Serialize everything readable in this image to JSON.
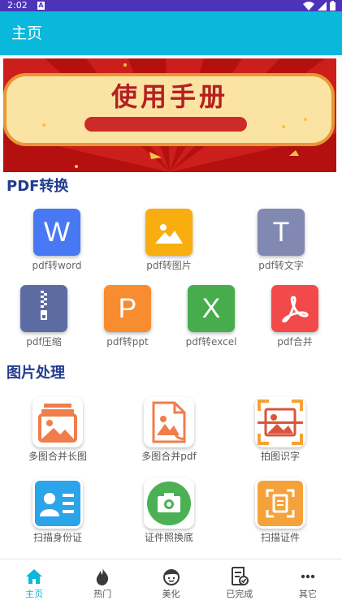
{
  "status_bar": {
    "time": "2:02",
    "notification_letter": "A"
  },
  "app_bar": {
    "title": "主页"
  },
  "banner": {
    "text": "使用手册"
  },
  "pdf_section": {
    "title": "PDF转换",
    "items": [
      {
        "label": "pdf转word",
        "glyph": "W",
        "color": "#4878f3"
      },
      {
        "label": "pdf转图片",
        "glyph": "",
        "color": "#f8ae0f"
      },
      {
        "label": "pdf转文字",
        "glyph": "T",
        "color": "#8189b3"
      },
      {
        "label": "pdf压缩",
        "glyph": "",
        "color": "#5d6ba3"
      },
      {
        "label": "pdf转ppt",
        "glyph": "P",
        "color": "#f88c31"
      },
      {
        "label": "pdf转excel",
        "glyph": "X",
        "color": "#47ad4c"
      },
      {
        "label": "pdf合并",
        "glyph": "",
        "color": "#f24a4a"
      }
    ]
  },
  "image_section": {
    "title": "图片处理",
    "items": [
      {
        "label": "多图合并长图"
      },
      {
        "label": "多图合并pdf"
      },
      {
        "label": "拍图识字"
      },
      {
        "label": "扫描身份证"
      },
      {
        "label": "证件照换底"
      },
      {
        "label": "扫描证件"
      }
    ]
  },
  "bottom_nav": {
    "items": [
      {
        "label": "主页",
        "active": true
      },
      {
        "label": "热门",
        "active": false
      },
      {
        "label": "美化",
        "active": false
      },
      {
        "label": "已完成",
        "active": false
      },
      {
        "label": "其它",
        "active": false
      }
    ]
  },
  "colors": {
    "accent": "#0ab8dc",
    "status_bar": "#4b34b8",
    "section_title": "#233c8e"
  }
}
